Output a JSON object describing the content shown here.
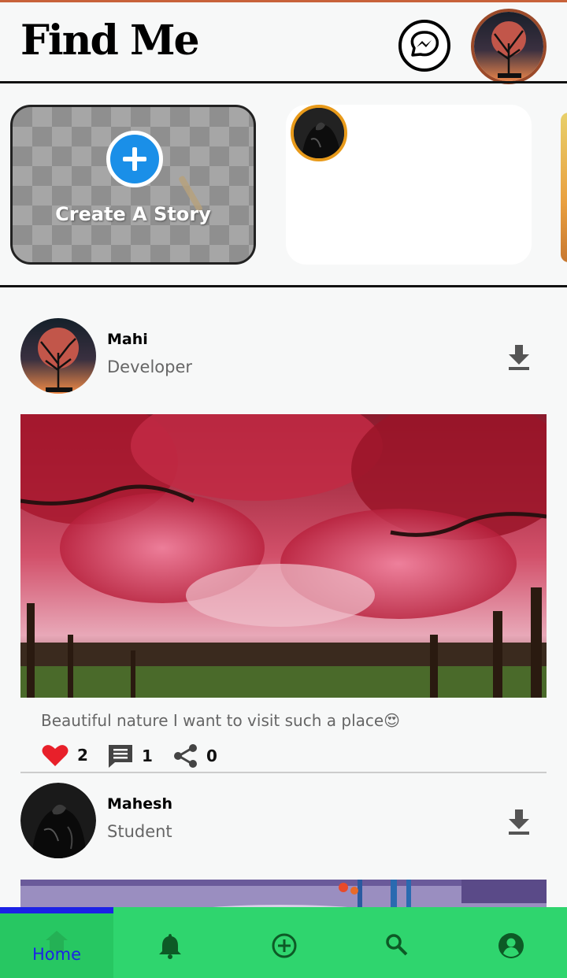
{
  "header": {
    "title": "Find Me",
    "messenger_icon": "messenger-icon",
    "profile_avatar": "profile-avatar"
  },
  "stories": {
    "create_label": "Create A Story",
    "create_icon": "add-circle-icon",
    "items": [
      {
        "avatar": "story-avatar"
      }
    ]
  },
  "posts": [
    {
      "name": "Mahi",
      "role": "Developer",
      "caption": "Beautiful nature I want to visit such a place😍",
      "likes": "2",
      "comments": "1",
      "shares": "0"
    },
    {
      "name": "Mahesh",
      "role": "Student"
    }
  ],
  "nav": {
    "items": [
      {
        "label": "Home",
        "icon": "home-icon",
        "active": true
      },
      {
        "icon": "bell-icon"
      },
      {
        "icon": "add-circle-icon"
      },
      {
        "icon": "search-icon"
      },
      {
        "icon": "account-icon"
      }
    ]
  },
  "colors": {
    "nav_bg": "#2fd56e",
    "nav_active_text": "#1c22e6",
    "like_red": "#e8202a",
    "story_ring": "#e89a1a",
    "create_plus": "#1a8fe8"
  }
}
